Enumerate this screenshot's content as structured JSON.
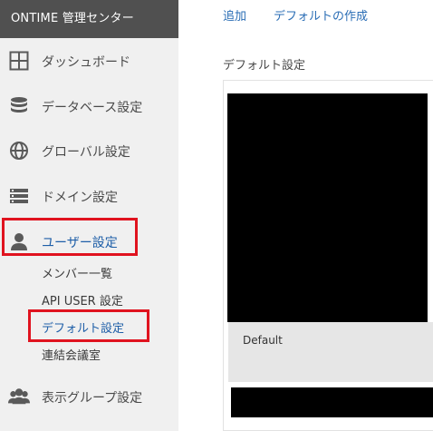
{
  "app": {
    "title": "ONTIME 管理センター"
  },
  "sidebar": {
    "items": [
      {
        "label": "ダッシュボード",
        "icon": "dashboard-grid-icon"
      },
      {
        "label": "データベース設定",
        "icon": "database-icon"
      },
      {
        "label": "グローバル設定",
        "icon": "globe-icon"
      },
      {
        "label": "ドメイン設定",
        "icon": "domain-list-icon"
      },
      {
        "label": "ユーザー設定",
        "icon": "user-icon"
      },
      {
        "label": "表示グループ設定",
        "icon": "group-users-icon"
      }
    ],
    "sub_items": [
      {
        "label": "メンバー一覧"
      },
      {
        "label": "API USER 設定"
      },
      {
        "label": "デフォルト設定"
      },
      {
        "label": "連結会議室"
      }
    ]
  },
  "toolbar": {
    "add_label": "追加",
    "create_default_label": "デフォルトの作成"
  },
  "main": {
    "section_title": "デフォルト設定",
    "card_caption": "Default"
  },
  "colors": {
    "brand_bg": "#505050",
    "sidebar_bg": "#f0f0f0",
    "link": "#2a6db5",
    "active": "#1f5fa8",
    "highlight": "#e0131f"
  }
}
